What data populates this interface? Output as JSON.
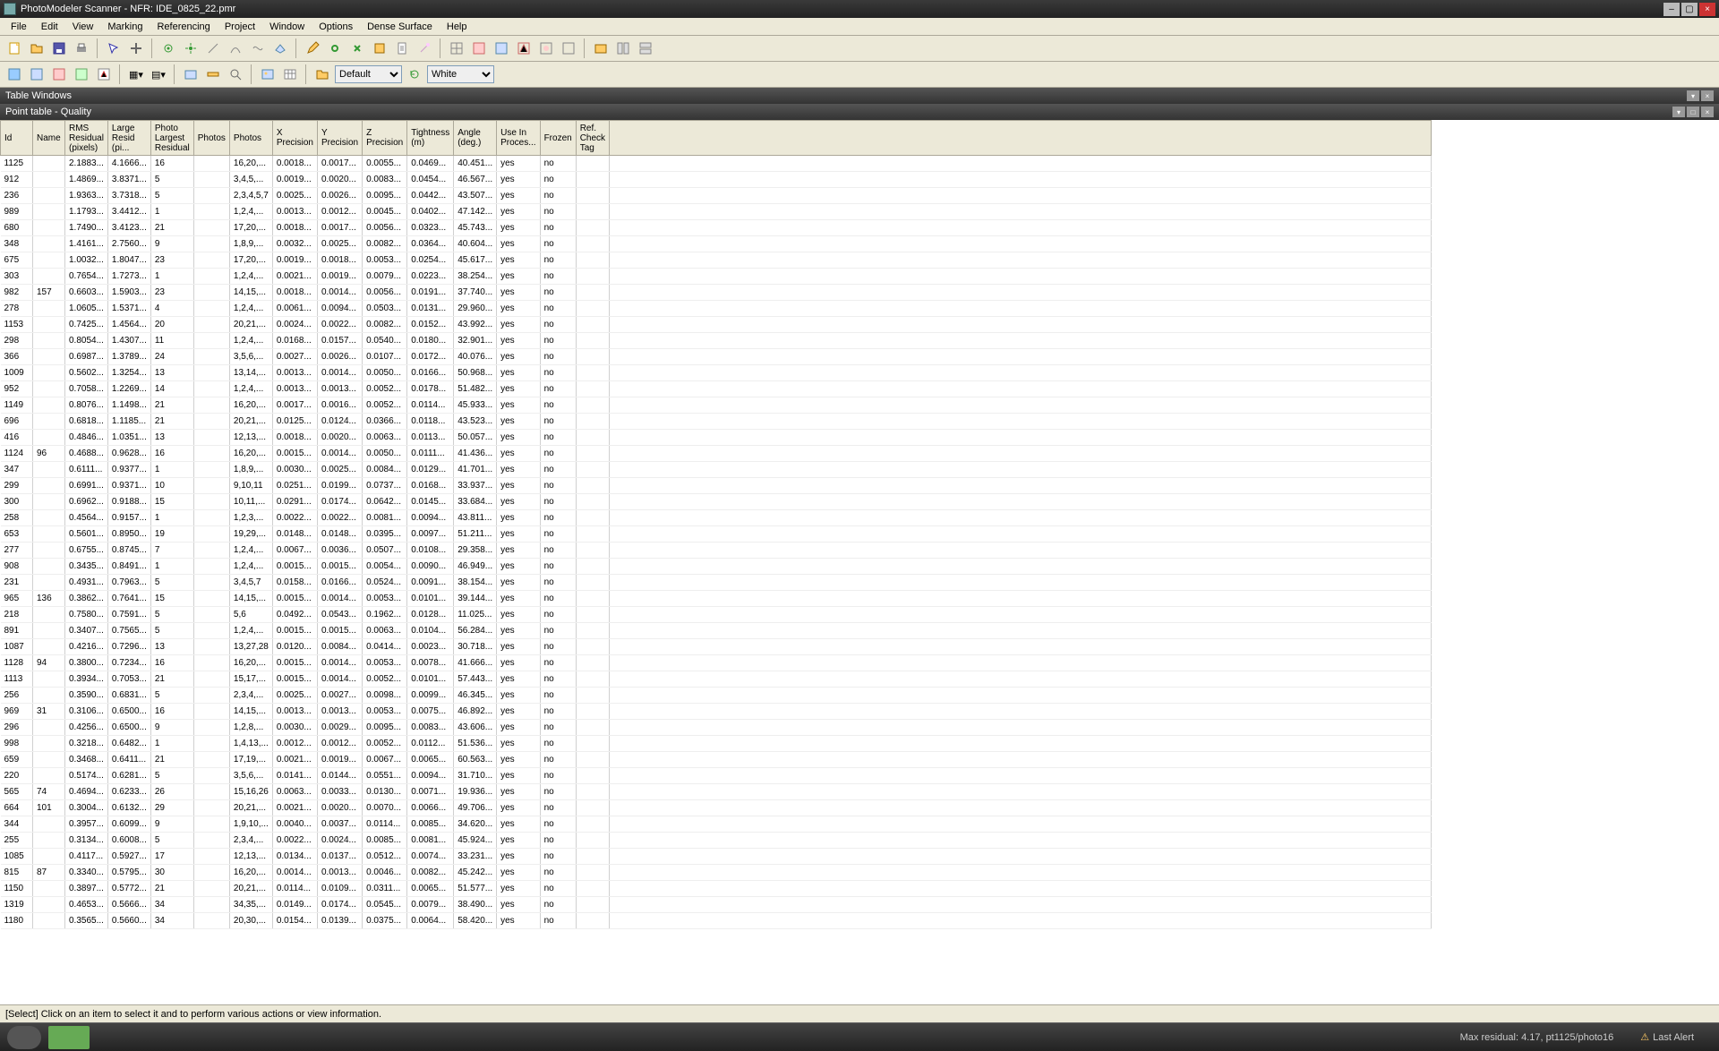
{
  "title": "PhotoModeler Scanner - NFR: IDE_0825_22.pmr",
  "menu": [
    "File",
    "Edit",
    "View",
    "Marking",
    "Referencing",
    "Project",
    "Window",
    "Options",
    "Dense Surface",
    "Help"
  ],
  "combo1": "Default",
  "combo2": "White",
  "panel1": "Table Windows",
  "panel2": "Point table - Quality",
  "columns": [
    "Id",
    "Name",
    "RMS Residual (pixels)",
    "Large Resid (pi...",
    "Photo Largest Residual",
    "Photos",
    "Photos",
    "X Precision",
    "Y Precision",
    "Z Precision",
    "Tightness (m)",
    "Angle (deg.)",
    "Use In Proces...",
    "Frozen",
    "Ref. Check Tag"
  ],
  "status": "[Select] Click on an item to select it and to perform various actions or view information.",
  "footer_right1": "Max residual: 4.17, pt1125/photo16",
  "footer_right2": "Last Alert",
  "rows": [
    [
      "1125",
      "",
      "2.1883...",
      "4.1666...",
      "16",
      "",
      "16,20,...",
      "0.0018...",
      "0.0017...",
      "0.0055...",
      "0.0469...",
      "40.451...",
      "yes",
      "no",
      ""
    ],
    [
      "912",
      "",
      "1.4869...",
      "3.8371...",
      "5",
      "",
      "3,4,5,...",
      "0.0019...",
      "0.0020...",
      "0.0083...",
      "0.0454...",
      "46.567...",
      "yes",
      "no",
      ""
    ],
    [
      "236",
      "",
      "1.9363...",
      "3.7318...",
      "5",
      "",
      "2,3,4,5,7",
      "0.0025...",
      "0.0026...",
      "0.0095...",
      "0.0442...",
      "43.507...",
      "yes",
      "no",
      ""
    ],
    [
      "989",
      "",
      "1.1793...",
      "3.4412...",
      "1",
      "",
      "1,2,4,...",
      "0.0013...",
      "0.0012...",
      "0.0045...",
      "0.0402...",
      "47.142...",
      "yes",
      "no",
      ""
    ],
    [
      "680",
      "",
      "1.7490...",
      "3.4123...",
      "21",
      "",
      "17,20,...",
      "0.0018...",
      "0.0017...",
      "0.0056...",
      "0.0323...",
      "45.743...",
      "yes",
      "no",
      ""
    ],
    [
      "348",
      "",
      "1.4161...",
      "2.7560...",
      "9",
      "",
      "1,8,9,...",
      "0.0032...",
      "0.0025...",
      "0.0082...",
      "0.0364...",
      "40.604...",
      "yes",
      "no",
      ""
    ],
    [
      "675",
      "",
      "1.0032...",
      "1.8047...",
      "23",
      "",
      "17,20,...",
      "0.0019...",
      "0.0018...",
      "0.0053...",
      "0.0254...",
      "45.617...",
      "yes",
      "no",
      ""
    ],
    [
      "303",
      "",
      "0.7654...",
      "1.7273...",
      "1",
      "",
      "1,2,4,...",
      "0.0021...",
      "0.0019...",
      "0.0079...",
      "0.0223...",
      "38.254...",
      "yes",
      "no",
      ""
    ],
    [
      "982",
      "157",
      "0.6603...",
      "1.5903...",
      "23",
      "",
      "14,15,...",
      "0.0018...",
      "0.0014...",
      "0.0056...",
      "0.0191...",
      "37.740...",
      "yes",
      "no",
      ""
    ],
    [
      "278",
      "",
      "1.0605...",
      "1.5371...",
      "4",
      "",
      "1,2,4,...",
      "0.0061...",
      "0.0094...",
      "0.0503...",
      "0.0131...",
      "29.960...",
      "yes",
      "no",
      ""
    ],
    [
      "1153",
      "",
      "0.7425...",
      "1.4564...",
      "20",
      "",
      "20,21,...",
      "0.0024...",
      "0.0022...",
      "0.0082...",
      "0.0152...",
      "43.992...",
      "yes",
      "no",
      ""
    ],
    [
      "298",
      "",
      "0.8054...",
      "1.4307...",
      "11",
      "",
      "1,2,4,...",
      "0.0168...",
      "0.0157...",
      "0.0540...",
      "0.0180...",
      "32.901...",
      "yes",
      "no",
      ""
    ],
    [
      "366",
      "",
      "0.6987...",
      "1.3789...",
      "24",
      "",
      "3,5,6,...",
      "0.0027...",
      "0.0026...",
      "0.0107...",
      "0.0172...",
      "40.076...",
      "yes",
      "no",
      ""
    ],
    [
      "1009",
      "",
      "0.5602...",
      "1.3254...",
      "13",
      "",
      "13,14,...",
      "0.0013...",
      "0.0014...",
      "0.0050...",
      "0.0166...",
      "50.968...",
      "yes",
      "no",
      ""
    ],
    [
      "952",
      "",
      "0.7058...",
      "1.2269...",
      "14",
      "",
      "1,2,4,...",
      "0.0013...",
      "0.0013...",
      "0.0052...",
      "0.0178...",
      "51.482...",
      "yes",
      "no",
      ""
    ],
    [
      "1149",
      "",
      "0.8076...",
      "1.1498...",
      "21",
      "",
      "16,20,...",
      "0.0017...",
      "0.0016...",
      "0.0052...",
      "0.0114...",
      "45.933...",
      "yes",
      "no",
      ""
    ],
    [
      "696",
      "",
      "0.6818...",
      "1.1185...",
      "21",
      "",
      "20,21,...",
      "0.0125...",
      "0.0124...",
      "0.0366...",
      "0.0118...",
      "43.523...",
      "yes",
      "no",
      ""
    ],
    [
      "416",
      "",
      "0.4846...",
      "1.0351...",
      "13",
      "",
      "12,13,...",
      "0.0018...",
      "0.0020...",
      "0.0063...",
      "0.0113...",
      "50.057...",
      "yes",
      "no",
      ""
    ],
    [
      "1124",
      "96",
      "0.4688...",
      "0.9628...",
      "16",
      "",
      "16,20,...",
      "0.0015...",
      "0.0014...",
      "0.0050...",
      "0.0111...",
      "41.436...",
      "yes",
      "no",
      ""
    ],
    [
      "347",
      "",
      "0.6111...",
      "0.9377...",
      "1",
      "",
      "1,8,9,...",
      "0.0030...",
      "0.0025...",
      "0.0084...",
      "0.0129...",
      "41.701...",
      "yes",
      "no",
      ""
    ],
    [
      "299",
      "",
      "0.6991...",
      "0.9371...",
      "10",
      "",
      "9,10,11",
      "0.0251...",
      "0.0199...",
      "0.0737...",
      "0.0168...",
      "33.937...",
      "yes",
      "no",
      ""
    ],
    [
      "300",
      "",
      "0.6962...",
      "0.9188...",
      "15",
      "",
      "10,11,...",
      "0.0291...",
      "0.0174...",
      "0.0642...",
      "0.0145...",
      "33.684...",
      "yes",
      "no",
      ""
    ],
    [
      "258",
      "",
      "0.4564...",
      "0.9157...",
      "1",
      "",
      "1,2,3,...",
      "0.0022...",
      "0.0022...",
      "0.0081...",
      "0.0094...",
      "43.811...",
      "yes",
      "no",
      ""
    ],
    [
      "653",
      "",
      "0.5601...",
      "0.8950...",
      "19",
      "",
      "19,29,...",
      "0.0148...",
      "0.0148...",
      "0.0395...",
      "0.0097...",
      "51.211...",
      "yes",
      "no",
      ""
    ],
    [
      "277",
      "",
      "0.6755...",
      "0.8745...",
      "7",
      "",
      "1,2,4,...",
      "0.0067...",
      "0.0036...",
      "0.0507...",
      "0.0108...",
      "29.358...",
      "yes",
      "no",
      ""
    ],
    [
      "908",
      "",
      "0.3435...",
      "0.8491...",
      "1",
      "",
      "1,2,4,...",
      "0.0015...",
      "0.0015...",
      "0.0054...",
      "0.0090...",
      "46.949...",
      "yes",
      "no",
      ""
    ],
    [
      "231",
      "",
      "0.4931...",
      "0.7963...",
      "5",
      "",
      "3,4,5,7",
      "0.0158...",
      "0.0166...",
      "0.0524...",
      "0.0091...",
      "38.154...",
      "yes",
      "no",
      ""
    ],
    [
      "965",
      "136",
      "0.3862...",
      "0.7641...",
      "15",
      "",
      "14,15,...",
      "0.0015...",
      "0.0014...",
      "0.0053...",
      "0.0101...",
      "39.144...",
      "yes",
      "no",
      ""
    ],
    [
      "218",
      "",
      "0.7580...",
      "0.7591...",
      "5",
      "",
      "5,6",
      "0.0492...",
      "0.0543...",
      "0.1962...",
      "0.0128...",
      "11.025...",
      "yes",
      "no",
      ""
    ],
    [
      "891",
      "",
      "0.3407...",
      "0.7565...",
      "5",
      "",
      "1,2,4,...",
      "0.0015...",
      "0.0015...",
      "0.0063...",
      "0.0104...",
      "56.284...",
      "yes",
      "no",
      ""
    ],
    [
      "1087",
      "",
      "0.4216...",
      "0.7296...",
      "13",
      "",
      "13,27,28",
      "0.0120...",
      "0.0084...",
      "0.0414...",
      "0.0023...",
      "30.718...",
      "yes",
      "no",
      ""
    ],
    [
      "1128",
      "94",
      "0.3800...",
      "0.7234...",
      "16",
      "",
      "16,20,...",
      "0.0015...",
      "0.0014...",
      "0.0053...",
      "0.0078...",
      "41.666...",
      "yes",
      "no",
      ""
    ],
    [
      "1113",
      "",
      "0.3934...",
      "0.7053...",
      "21",
      "",
      "15,17,...",
      "0.0015...",
      "0.0014...",
      "0.0052...",
      "0.0101...",
      "57.443...",
      "yes",
      "no",
      ""
    ],
    [
      "256",
      "",
      "0.3590...",
      "0.6831...",
      "5",
      "",
      "2,3,4,...",
      "0.0025...",
      "0.0027...",
      "0.0098...",
      "0.0099...",
      "46.345...",
      "yes",
      "no",
      ""
    ],
    [
      "969",
      "31",
      "0.3106...",
      "0.6500...",
      "16",
      "",
      "14,15,...",
      "0.0013...",
      "0.0013...",
      "0.0053...",
      "0.0075...",
      "46.892...",
      "yes",
      "no",
      ""
    ],
    [
      "296",
      "",
      "0.4256...",
      "0.6500...",
      "9",
      "",
      "1,2,8,...",
      "0.0030...",
      "0.0029...",
      "0.0095...",
      "0.0083...",
      "43.606...",
      "yes",
      "no",
      ""
    ],
    [
      "998",
      "",
      "0.3218...",
      "0.6482...",
      "1",
      "",
      "1,4,13,...",
      "0.0012...",
      "0.0012...",
      "0.0052...",
      "0.0112...",
      "51.536...",
      "yes",
      "no",
      ""
    ],
    [
      "659",
      "",
      "0.3468...",
      "0.6411...",
      "21",
      "",
      "17,19,...",
      "0.0021...",
      "0.0019...",
      "0.0067...",
      "0.0065...",
      "60.563...",
      "yes",
      "no",
      ""
    ],
    [
      "220",
      "",
      "0.5174...",
      "0.6281...",
      "5",
      "",
      "3,5,6,...",
      "0.0141...",
      "0.0144...",
      "0.0551...",
      "0.0094...",
      "31.710...",
      "yes",
      "no",
      ""
    ],
    [
      "565",
      "74",
      "0.4694...",
      "0.6233...",
      "26",
      "",
      "15,16,26",
      "0.0063...",
      "0.0033...",
      "0.0130...",
      "0.0071...",
      "19.936...",
      "yes",
      "no",
      ""
    ],
    [
      "664",
      "101",
      "0.3004...",
      "0.6132...",
      "29",
      "",
      "20,21,...",
      "0.0021...",
      "0.0020...",
      "0.0070...",
      "0.0066...",
      "49.706...",
      "yes",
      "no",
      ""
    ],
    [
      "344",
      "",
      "0.3957...",
      "0.6099...",
      "9",
      "",
      "1,9,10,...",
      "0.0040...",
      "0.0037...",
      "0.0114...",
      "0.0085...",
      "34.620...",
      "yes",
      "no",
      ""
    ],
    [
      "255",
      "",
      "0.3134...",
      "0.6008...",
      "5",
      "",
      "2,3,4,...",
      "0.0022...",
      "0.0024...",
      "0.0085...",
      "0.0081...",
      "45.924...",
      "yes",
      "no",
      ""
    ],
    [
      "1085",
      "",
      "0.4117...",
      "0.5927...",
      "17",
      "",
      "12,13,...",
      "0.0134...",
      "0.0137...",
      "0.0512...",
      "0.0074...",
      "33.231...",
      "yes",
      "no",
      ""
    ],
    [
      "815",
      "87",
      "0.3340...",
      "0.5795...",
      "30",
      "",
      "16,20,...",
      "0.0014...",
      "0.0013...",
      "0.0046...",
      "0.0082...",
      "45.242...",
      "yes",
      "no",
      ""
    ],
    [
      "1150",
      "",
      "0.3897...",
      "0.5772...",
      "21",
      "",
      "20,21,...",
      "0.0114...",
      "0.0109...",
      "0.0311...",
      "0.0065...",
      "51.577...",
      "yes",
      "no",
      ""
    ],
    [
      "1319",
      "",
      "0.4653...",
      "0.5666...",
      "34",
      "",
      "34,35,...",
      "0.0149...",
      "0.0174...",
      "0.0545...",
      "0.0079...",
      "38.490...",
      "yes",
      "no",
      ""
    ],
    [
      "1180",
      "",
      "0.3565...",
      "0.5660...",
      "34",
      "",
      "20,30,...",
      "0.0154...",
      "0.0139...",
      "0.0375...",
      "0.0064...",
      "58.420...",
      "yes",
      "no",
      ""
    ]
  ]
}
